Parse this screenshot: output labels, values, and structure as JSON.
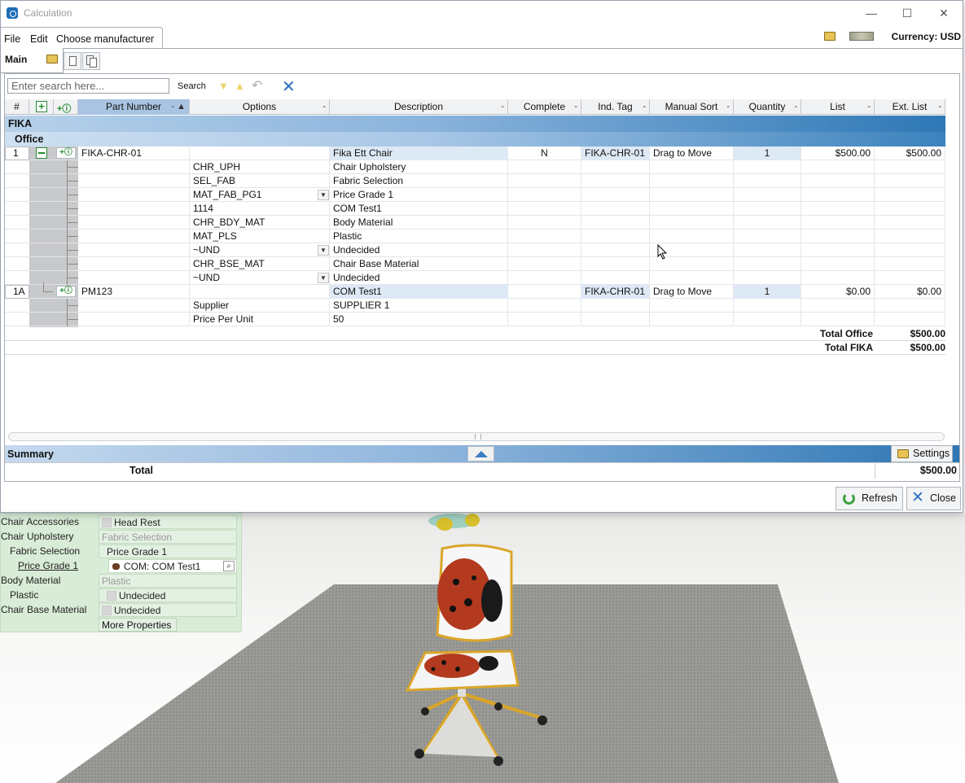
{
  "window": {
    "title": "Calculation",
    "minimize": "—",
    "maximize": "☐",
    "close": "✕"
  },
  "menu": {
    "file": "File",
    "edit": "Edit",
    "manufacturer": "Choose manufacturer",
    "currency": "Currency: USD"
  },
  "tabs": {
    "main": "Main"
  },
  "search": {
    "placeholder": "Enter search here...",
    "button": "Search"
  },
  "columns": {
    "num": "#",
    "part_number": "Part Number",
    "options": "Options",
    "description": "Description",
    "complete": "Complete",
    "ind_tag": "Ind. Tag",
    "manual_sort": "Manual Sort",
    "quantity": "Quantity",
    "list": "List",
    "ext_list": "Ext. List"
  },
  "group": {
    "name": "FIKA",
    "subgroup": "Office"
  },
  "rows": [
    {
      "num": "1",
      "part": "FIKA-CHR-01",
      "option": "",
      "desc": "Fika Ett Chair",
      "complete": "N",
      "tag": "FIKA-CHR-01",
      "sort": "Drag to Move",
      "qty": "1",
      "list": "$500.00",
      "ext": "$500.00"
    },
    {
      "option": "CHR_UPH",
      "desc": "Chair Upholstery"
    },
    {
      "option": "SEL_FAB",
      "desc": "Fabric Selection"
    },
    {
      "option": "MAT_FAB_PG1",
      "desc": "Price Grade 1"
    },
    {
      "option": "1114",
      "desc": "COM Test1"
    },
    {
      "option": "CHR_BDY_MAT",
      "desc": "Body Material"
    },
    {
      "option": "MAT_PLS",
      "desc": "Plastic"
    },
    {
      "option": "~UND",
      "desc": "Undecided"
    },
    {
      "option": "CHR_BSE_MAT",
      "desc": "Chair Base Material"
    },
    {
      "option": "~UND",
      "desc": "Undecided"
    },
    {
      "num": "1A",
      "part": "PM123",
      "option": "",
      "desc": "COM Test1",
      "tag": "FIKA-CHR-01",
      "sort": "Drag to Move",
      "qty": "1",
      "list": "$0.00",
      "ext": "$0.00"
    },
    {
      "option": "Supplier",
      "desc": "SUPPLIER 1"
    },
    {
      "option": "Price Per Unit",
      "desc": "50"
    }
  ],
  "totals": {
    "office_label": "Total Office",
    "office_value": "$500.00",
    "fika_label": "Total FIKA",
    "fika_value": "$500.00"
  },
  "summary": {
    "label": "Summary",
    "settings": "Settings",
    "total_label": "Total",
    "total_value": "$500.00"
  },
  "footer": {
    "refresh": "Refresh",
    "close": "Close"
  },
  "properties": {
    "chair_accessories": "Chair Accessories",
    "head_rest": "Head Rest",
    "chair_upholstery": "Chair Upholstery",
    "fabric_selection_grey": "Fabric Selection",
    "fabric_selection": "Fabric Selection",
    "price_grade_1": "Price Grade 1",
    "price_grade_link": "Price Grade 1",
    "com_value": "COM: COM Test1",
    "body_material": "Body Material",
    "plastic_grey": "Plastic",
    "plastic": "Plastic",
    "undecided_1": "Undecided",
    "chair_base_material": "Chair Base Material",
    "undecided_2": "Undecided",
    "more_properties": "More Properties"
  }
}
